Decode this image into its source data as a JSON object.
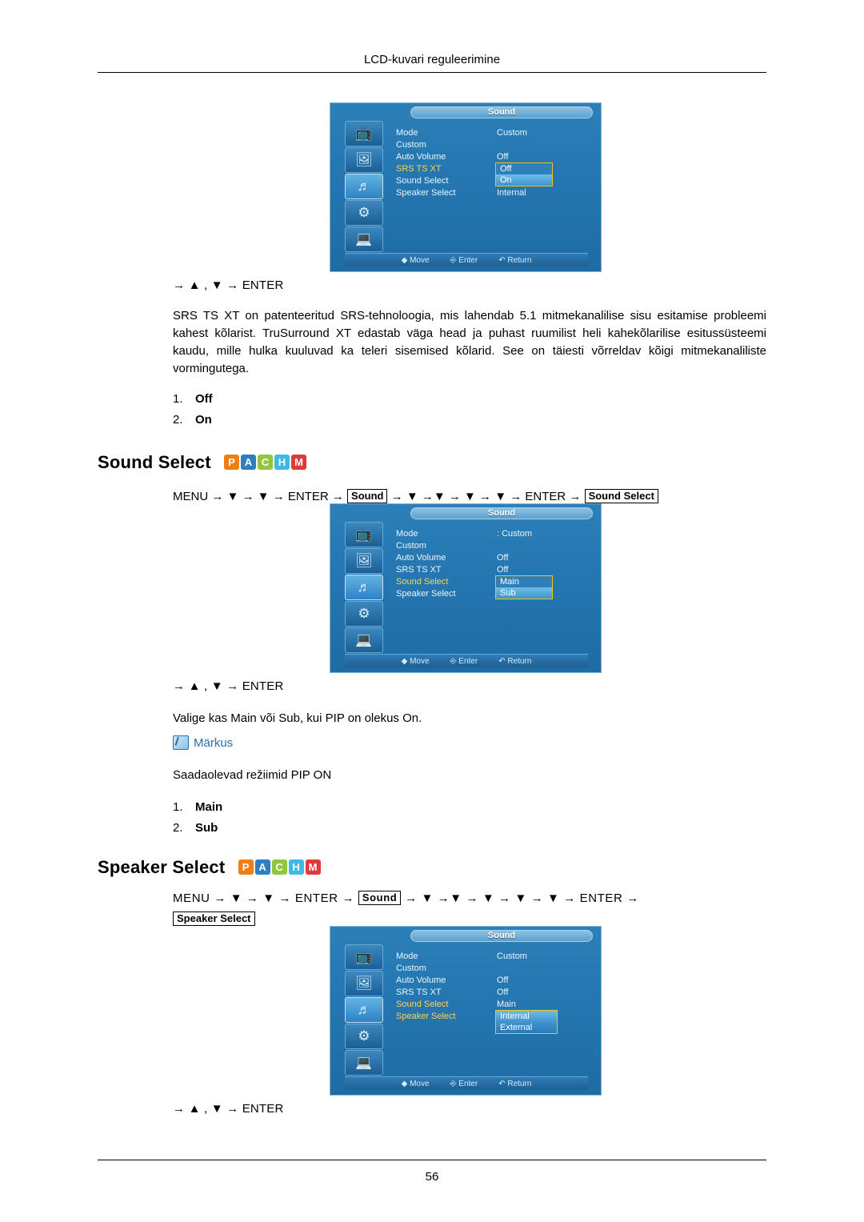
{
  "header": {
    "title": "LCD-kuvari reguleerimine"
  },
  "footer": {
    "page_number": "56"
  },
  "osd_common": {
    "title": "Sound",
    "labels": [
      "Mode",
      "Custom",
      "Auto Volume",
      "SRS TS XT",
      "Sound Select",
      "Speaker Select"
    ],
    "foot_move": "Move",
    "foot_enter": "Enter",
    "foot_return": "Return"
  },
  "osd1": {
    "title": "Sound",
    "labels": [
      "Mode",
      "Custom",
      "Auto Volume",
      "SRS TS XT",
      "Sound Select",
      "Speaker Select"
    ],
    "highlight_label": "SRS TS XT",
    "values": [
      "Custom",
      "Off",
      "Internal"
    ],
    "dropdown": {
      "options": [
        "Off",
        "On"
      ],
      "selected": "On"
    }
  },
  "osd2": {
    "title": "Sound",
    "labels": [
      "Mode",
      "Custom",
      "Auto Volume",
      "SRS TS XT",
      "Sound Select",
      "Speaker Select"
    ],
    "highlight_label": "Sound Select",
    "values": [
      ": Custom",
      "Off",
      "Off"
    ],
    "dropdown": {
      "options": [
        "Main",
        "Sub"
      ],
      "selected": "Sub"
    }
  },
  "osd3": {
    "title": "Sound",
    "labels": [
      "Mode",
      "Custom",
      "Auto Volume",
      "SRS TS XT",
      "Sound Select",
      "Speaker Select"
    ],
    "highlight_labels": [
      "Sound Select",
      "Speaker Select"
    ],
    "values": [
      "Custom",
      "Off",
      "Off",
      "Main"
    ],
    "dropdown": {
      "options": [
        "Internal",
        "External"
      ],
      "selected": "External"
    }
  },
  "key_lines": {
    "line1": "→ ▲ , ▼ → ENTER",
    "line2": "→ ▲ , ▼ → ENTER",
    "line3": "→ ▲ , ▼ → ENTER"
  },
  "srs": {
    "paragraph": "SRS TS XT on patenteeritud SRS-tehnoloogia, mis lahendab 5.1 mitmekanalilise sisu esitamise probleemi kahest kõlarist. TruSurround XT edastab väga head ja puhast ruumilist heli kahekõlarilise esitussüsteemi kaudu, mille hulka kuuluvad ka teleri sisemised kõlarid. See on täiesti võrreldav kõigi mitmekanaliliste vormingutega.",
    "options": [
      {
        "num": "1.",
        "value": "Off"
      },
      {
        "num": "2.",
        "value": "On"
      }
    ]
  },
  "sound_select": {
    "heading": "Sound Select",
    "badges": [
      {
        "letter": "P",
        "color": "#f07f13"
      },
      {
        "letter": "A",
        "color": "#2e7fc1"
      },
      {
        "letter": "C",
        "color": "#8fc73e"
      },
      {
        "letter": "H",
        "color": "#3fb9e5"
      },
      {
        "letter": "M",
        "color": "#e23a3a"
      }
    ],
    "path_prefix": "MENU → ▼ → ▼ → ENTER →",
    "path_tag1": "Sound",
    "path_middle": "→ ▼ →▼ → ▼ → ▼ → ENTER →",
    "path_tag2": "Sound Select",
    "description": "Valige kas Main või Sub, kui PIP on olekus On.",
    "note_label": "Märkus",
    "note_text": "Saadaolevad režiimid PIP ON",
    "options": [
      {
        "num": "1.",
        "value": "Main"
      },
      {
        "num": "2.",
        "value": "Sub"
      }
    ]
  },
  "speaker_select": {
    "heading": "Speaker Select",
    "badges": [
      {
        "letter": "P",
        "color": "#f07f13"
      },
      {
        "letter": "A",
        "color": "#2e7fc1"
      },
      {
        "letter": "C",
        "color": "#8fc73e"
      },
      {
        "letter": "H",
        "color": "#3fb9e5"
      },
      {
        "letter": "M",
        "color": "#e23a3a"
      }
    ],
    "path_prefix": "MENU → ▼ → ▼ → ENTER →",
    "path_tag1": "Sound",
    "path_middle": "→ ▼ →▼ → ▼ → ▼ → ▼ → ENTER →",
    "path_tag2": "Speaker Select"
  }
}
